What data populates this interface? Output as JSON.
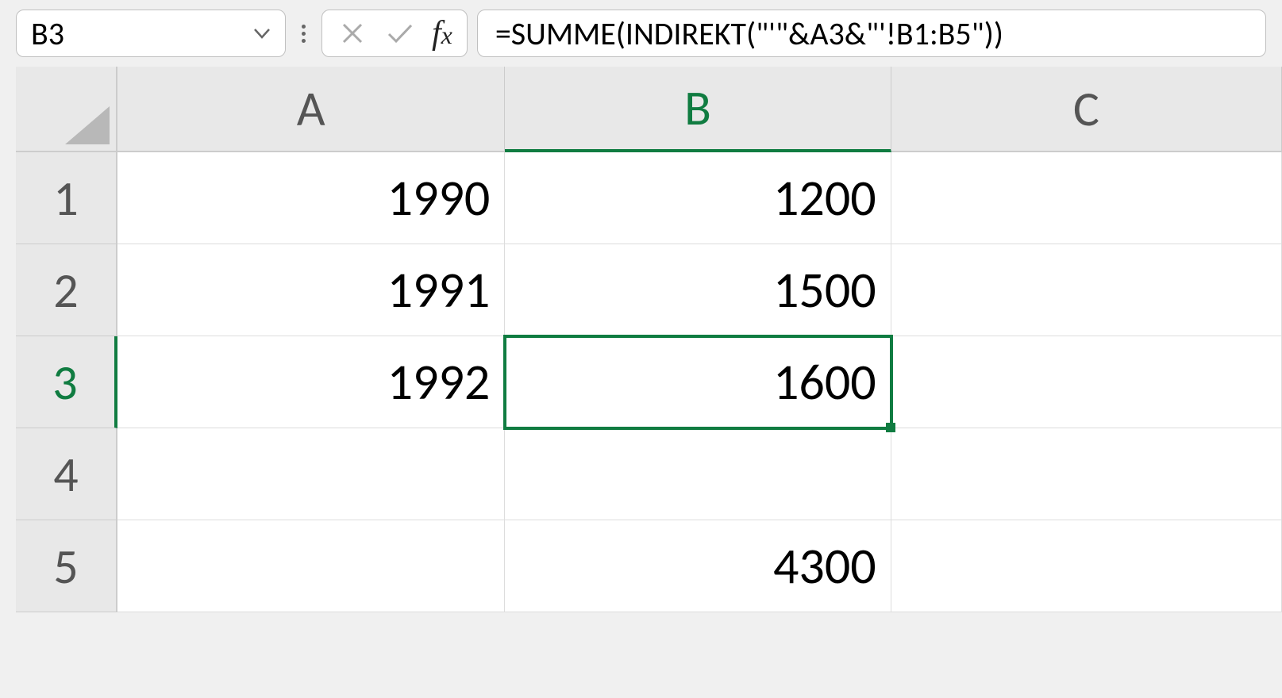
{
  "name_box": {
    "value": "B3"
  },
  "formula_bar": {
    "formula": "=SUMME(INDIREKT(\"'\"&A3&\"'!B1:B5\"))"
  },
  "columns": [
    "A",
    "B",
    "C"
  ],
  "rows": [
    "1",
    "2",
    "3",
    "4",
    "5"
  ],
  "cells": {
    "A1": "1990",
    "B1": "1200",
    "C1": "",
    "A2": "1991",
    "B2": "1500",
    "C2": "",
    "A3": "1992",
    "B3": "1600",
    "C3": "",
    "A4": "",
    "B4": "",
    "C4": "",
    "A5": "",
    "B5": "4300",
    "C5": ""
  },
  "selected_cell": "B3",
  "selected_column": "B",
  "selected_row": "3"
}
